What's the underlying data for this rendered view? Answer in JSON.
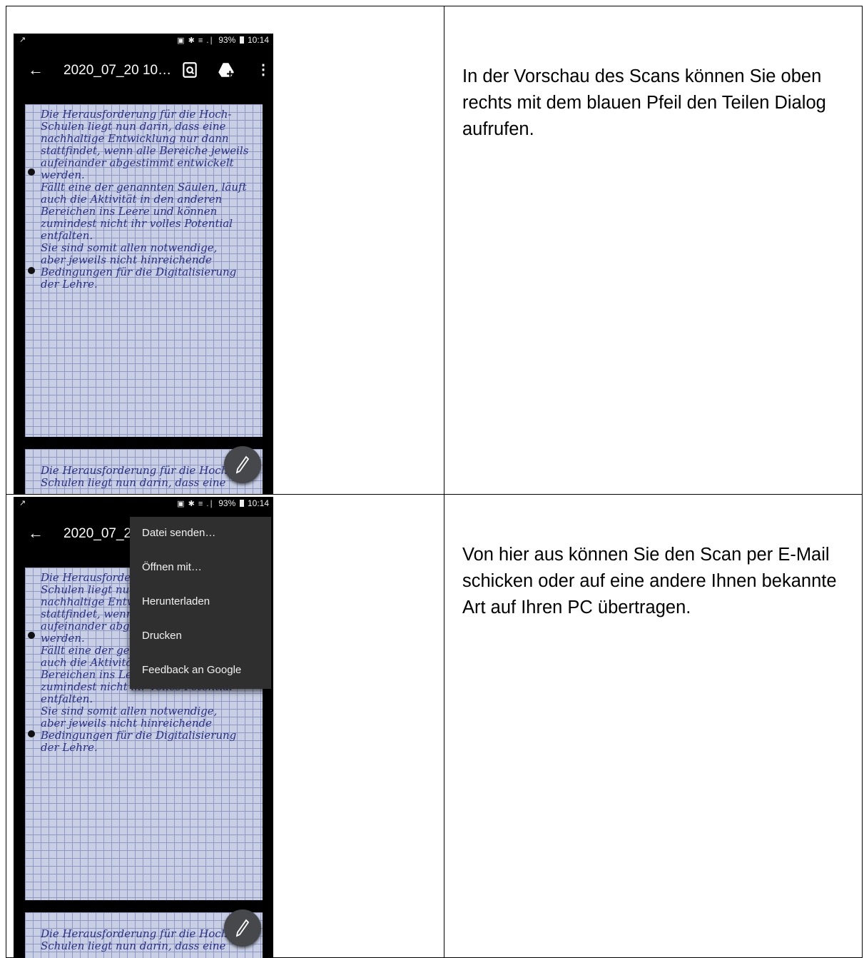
{
  "rows": [
    {
      "phone": {
        "status": {
          "left_icon": "chart-icon",
          "glyphs": "▣ ✱ ≡ .∣",
          "battery_percent": "93%",
          "time": "10:14"
        },
        "toolbar": {
          "title": "2020_07_20 10…",
          "back_icon": "arrow-back-icon",
          "icons": [
            "find-in-page-icon",
            "drive-add-icon",
            "more-vert-icon"
          ]
        },
        "fab_icon": "pencil-icon"
      },
      "text": "In der Vorschau des Scans können Sie oben rechts mit dem blauen Pfeil den Teilen Dialog aufrufen."
    },
    {
      "phone": {
        "status": {
          "left_icon": "chart-icon",
          "glyphs": "▣ ✱ ≡ .∣",
          "battery_percent": "93%",
          "time": "10:14"
        },
        "toolbar": {
          "title": "2020_07_2",
          "back_icon": "arrow-back-icon"
        },
        "menu": [
          "Datei senden…",
          "Öffnen mit…",
          "Herunterladen",
          "Drucken",
          "Feedback an Google"
        ],
        "fab_icon": "pencil-icon"
      },
      "text": "Von hier aus können Sie den Scan per E-Mail schicken oder auf eine andere Ihnen bekannte Art auf Ihren PC übertragen."
    }
  ],
  "scan": {
    "lines": [
      "Die Herausforderung für die Hoch-",
      "Schulen liegt nun darin, dass eine",
      "nachhaltige Entwicklung nur dann",
      "stattfindet, wenn alle Bereiche jeweils",
      "aufeinander abgestimmt entwickelt werden.",
      "Fällt eine der genannten Säulen, läuft",
      "auch die Aktivität in den anderen",
      "Bereichen ins Leere und können",
      "zumindest nicht ihr volles Potential",
      "entfalten.",
      "Sie sind somit allen notwendige,",
      "aber jeweils nicht hinreichende",
      "Bedingungen für die Digitalisierung",
      "der Lehre."
    ],
    "bottom_lines": [
      "Die Herausforderung für die Hoch-",
      "Schulen liegt nun darin, dass eine"
    ]
  }
}
